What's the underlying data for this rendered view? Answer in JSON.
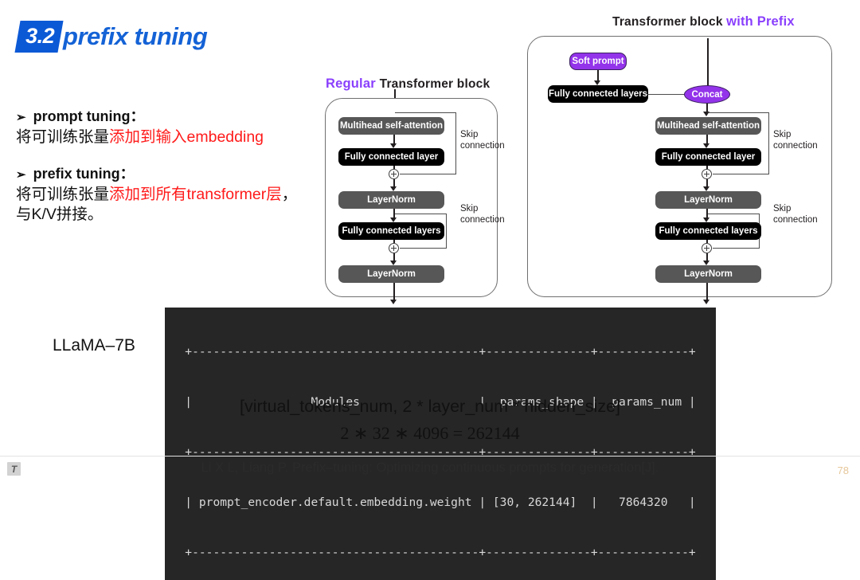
{
  "title": {
    "badge": "3.2",
    "text": "prefix tuning"
  },
  "notes": [
    {
      "bullet": "➢",
      "heading": "prompt tuning：",
      "body_plain_1": "将可训练张量",
      "body_highlight_1": "添加到输入embedding",
      "body_plain_2": "",
      "body_highlight_2": "",
      "body_plain_3": ""
    },
    {
      "bullet": "➢",
      "heading": "prefix tuning：",
      "body_plain_1": "将可训练张量",
      "body_highlight_1": "添加到所有transformer层",
      "body_plain_2": "，",
      "body_highlight_2": "",
      "body_plain_3": "与K/V拼接。"
    }
  ],
  "diagram_regular": {
    "title_purple": "Regular",
    "title_rest": "Transformer block",
    "nodes": {
      "mhsa": "Multihead self-attention",
      "fc_layer": "Fully connected layer",
      "layernorm_1": "LayerNorm",
      "fc_layers": "Fully connected layers",
      "layernorm_2": "LayerNorm"
    },
    "skip_label_1": "Skip\nconnection",
    "skip_label_2": "Skip\nconnection"
  },
  "diagram_prefix": {
    "title_rest": "Transformer block",
    "title_purple": "with Prefix",
    "nodes": {
      "soft_prompt": "Soft prompt",
      "fc_layers_prefix": "Fully connected layers",
      "concat": "Concat",
      "mhsa": "Multihead self-attention",
      "fc_layer": "Fully connected layer",
      "layernorm_1": "LayerNorm",
      "fc_layers": "Fully connected layers",
      "layernorm_2": "LayerNorm"
    },
    "skip_label_1": "Skip\nconnection",
    "skip_label_2": "Skip\nconnection"
  },
  "model_label": "LLaMA–7B",
  "terminal_table": {
    "columns": [
      "Modules",
      "params_shape",
      "params_num"
    ],
    "rows": [
      [
        "prompt_encoder.default.embedding.weight",
        "[30, 262144]",
        "7864320"
      ]
    ],
    "lines": [
      "+-----------------------------------------+---------------+-------------+",
      "|                 Modules                 |  params_shape |  params_num |",
      "+-----------------------------------------+---------------+-------------+",
      "| prompt_encoder.default.embedding.weight | [30, 262144]  |   7864320   |",
      "+-----------------------------------------+---------------+-------------+"
    ]
  },
  "shape_formula": "[virtual_tokens_num, 2 * layer_num * hidden_size]",
  "math_formula": "2 ∗ 32 ∗ 4096 = 262144",
  "footer": {
    "icon_glyph": "T",
    "citation": "Li X L, Liang P. Prefix–tuning: Optimizing continuous prompts for generation[J].",
    "page_number": "78"
  },
  "colors": {
    "brand_blue": "#1462d6",
    "badge_blue": "#0c59d6",
    "accent_purple": "#9333ea",
    "title_purple": "#8a3ffc",
    "highlight_red": "#ff1a1a",
    "node_gray": "#575757",
    "node_black": "#000000",
    "terminal_bg": "#262626",
    "page_number": "#e6c79a"
  }
}
